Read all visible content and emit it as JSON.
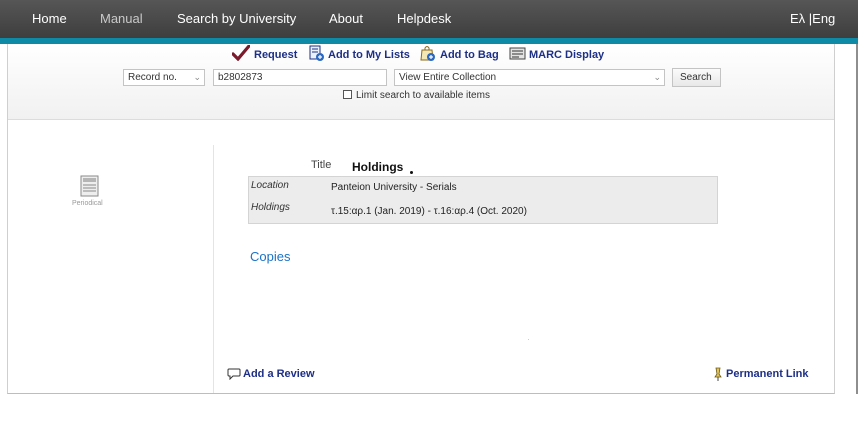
{
  "nav": {
    "items": [
      {
        "label": "Home"
      },
      {
        "label": "Manual"
      },
      {
        "label": "Search by University"
      },
      {
        "label": "About"
      },
      {
        "label": "Helpdesk"
      }
    ],
    "lang": "Eλ |Eng"
  },
  "toolbar": {
    "request": "Request",
    "add_to_lists": "Add to My Lists",
    "add_to_bag": "Add to Bag",
    "marc_display": "MARC Display"
  },
  "search": {
    "field_type": "Record no.",
    "query": "b2802873",
    "scope": "View Entire Collection",
    "button": "Search",
    "limit_label": "Limit search to available items"
  },
  "record": {
    "format_label": "Periodical",
    "title_label": "Title",
    "holdings_heading": "Holdings",
    "location_label": "Location",
    "location_value": "Panteion University - Serials",
    "holdings_label": "Holdings",
    "holdings_value": "τ.15:αρ.1 (Jan. 2019) - τ.16:αρ.4 (Oct. 2020)",
    "copies_link": "Copies"
  },
  "footer": {
    "add_review": "Add a Review",
    "permanent_link": "Permanent Link"
  },
  "colors": {
    "nav_bg": "#4a4a4a",
    "nav_accent": "#0f8aa6",
    "link_blue": "#1a73c8",
    "tool_blue": "#1d2f86"
  }
}
